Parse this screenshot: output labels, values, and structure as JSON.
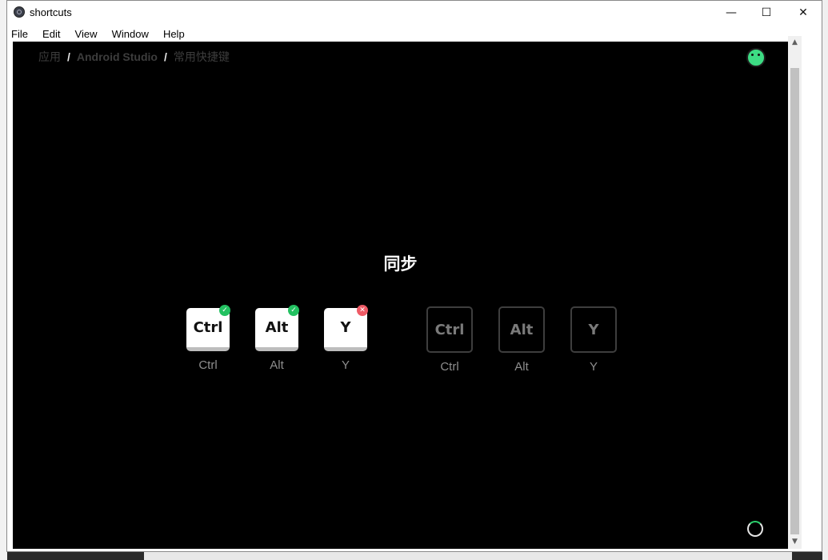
{
  "window": {
    "title": "shortcuts",
    "controls": {
      "minimize": "—",
      "maximize": "☐",
      "close": "✕"
    }
  },
  "menu": [
    "File",
    "Edit",
    "View",
    "Window",
    "Help"
  ],
  "breadcrumb": {
    "root": "应用",
    "sep": "/",
    "app": "Android Studio",
    "page": "常用快捷键"
  },
  "heading": "同步",
  "pressed_keys": [
    {
      "key": "Ctrl",
      "label": "Ctrl",
      "status": "correct",
      "badge": "✓"
    },
    {
      "key": "Alt",
      "label": "Alt",
      "status": "correct",
      "badge": "✓"
    },
    {
      "key": "Y",
      "label": "Y",
      "status": "wrong",
      "badge": "✕"
    }
  ],
  "expected_keys": [
    {
      "key": "Ctrl",
      "label": "Ctrl"
    },
    {
      "key": "Alt",
      "label": "Alt"
    },
    {
      "key": "Y",
      "label": "Y"
    }
  ],
  "colors": {
    "correct": "#23c161",
    "wrong": "#ef5b66",
    "android": "#3ddc84"
  },
  "icons": {
    "app": "electron-icon",
    "profile": "android-icon",
    "loading": "loading-spinner-icon"
  }
}
